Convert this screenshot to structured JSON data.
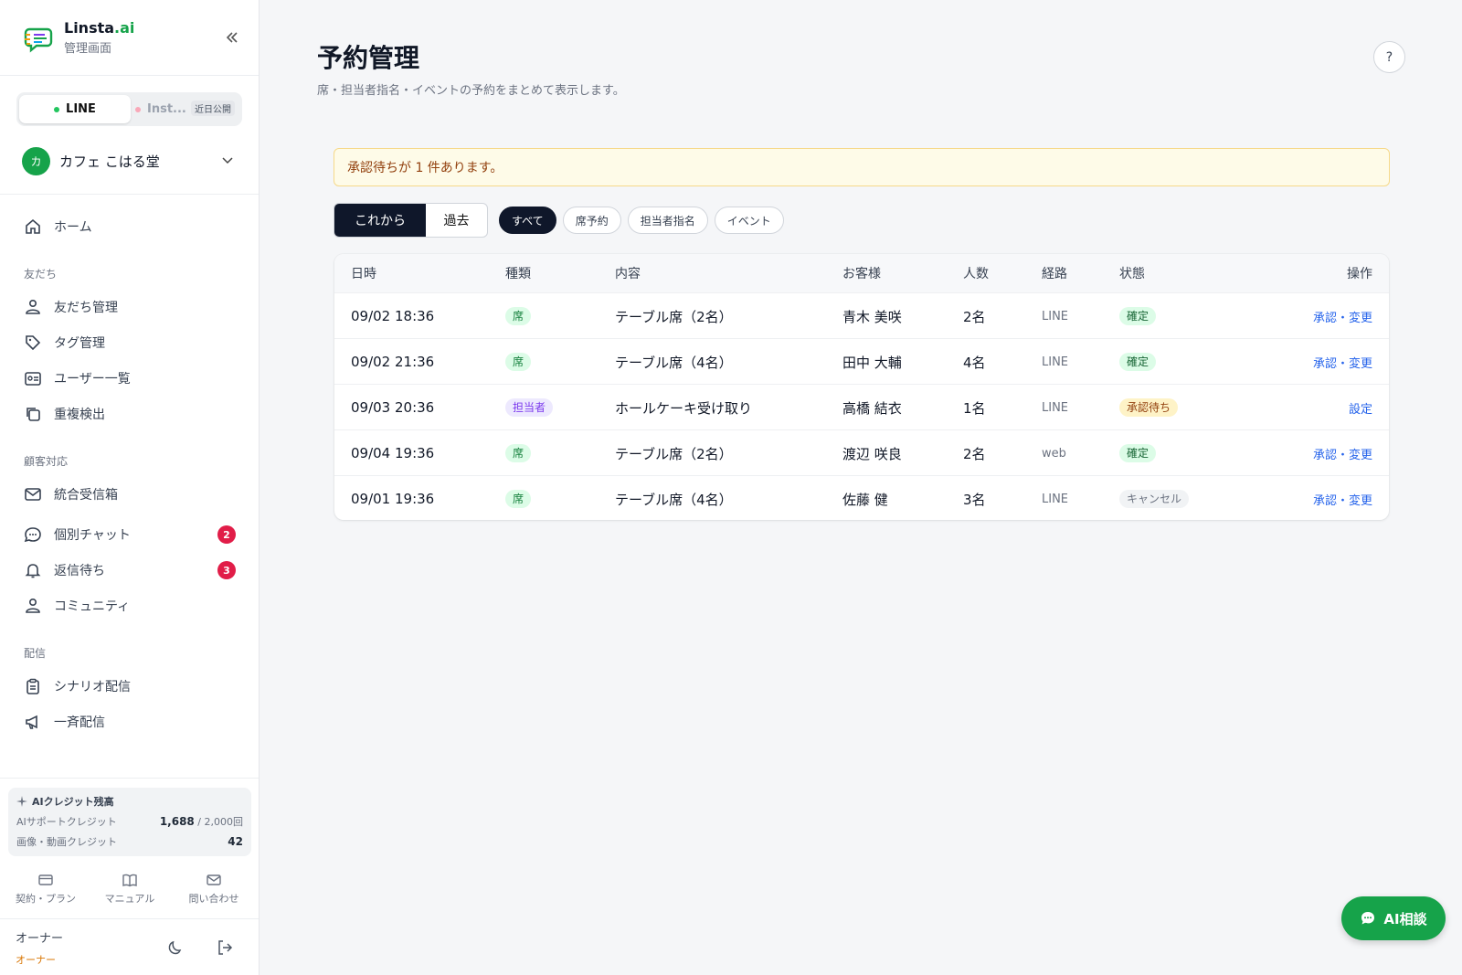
{
  "brand": {
    "name_main": "Linsta",
    "name_accent": ".ai",
    "subtitle": "管理画面"
  },
  "channels": {
    "line_label": "LINE",
    "insta_label": "Inst...",
    "soon_badge": "近日公開",
    "line_color": "#22c55e",
    "insta_color": "#f9a8b8"
  },
  "shop": {
    "avatar": "カ",
    "name": "カフェ こはる堂"
  },
  "nav": {
    "home": "ホーム",
    "group_friends": "友だち",
    "friends": "友だち管理",
    "tags": "タグ管理",
    "users": "ユーザー一覧",
    "duplicates": "重複検出",
    "group_support": "顧客対応",
    "inbox": "統合受信箱",
    "chat": "個別チャット",
    "chat_badge": "2",
    "waiting": "返信待ち",
    "waiting_badge": "3",
    "community": "コミュニティ",
    "group_delivery": "配信",
    "scenario": "シナリオ配信",
    "broadcast": "一斉配信"
  },
  "credits": {
    "title": "AIクレジット残高",
    "support_label": "AIサポートクレジット",
    "support_value": "1,688",
    "support_total": "/ 2,000回",
    "media_label": "画像・動画クレジット",
    "media_value": "42"
  },
  "quick": {
    "plan": "契約・プラン",
    "manual": "マニュアル",
    "contact": "問い合わせ"
  },
  "user": {
    "name": "オーナー",
    "role": "オーナー"
  },
  "page": {
    "title": "予約管理",
    "subtitle": "席・担当者指名・イベントの予約をまとめて表示します。",
    "help": "?"
  },
  "alert": "承認待ちが 1 件あります。",
  "segment": {
    "upcoming": "これから",
    "past": "過去"
  },
  "filters": [
    "すべて",
    "席予約",
    "担当者指名",
    "イベント"
  ],
  "table": {
    "headers": {
      "date": "日時",
      "type": "種類",
      "content": "内容",
      "customer": "お客様",
      "count": "人数",
      "source": "経路",
      "status": "状態",
      "action": "操作"
    },
    "rows": [
      {
        "date": "09/02 18:36",
        "type": "席",
        "content": "テーブル席（2名）",
        "customer": "青木 美咲",
        "count": "2名",
        "source": "LINE",
        "status": "確定",
        "action": "承認・変更"
      },
      {
        "date": "09/02 21:36",
        "type": "席",
        "content": "テーブル席（4名）",
        "customer": "田中 大輔",
        "count": "4名",
        "source": "LINE",
        "status": "確定",
        "action": "承認・変更"
      },
      {
        "date": "09/03 20:36",
        "type": "担当者",
        "content": "ホールケーキ受け取り",
        "customer": "高橋 結衣",
        "count": "1名",
        "source": "LINE",
        "status": "承認待ち",
        "action": "設定"
      },
      {
        "date": "09/04 19:36",
        "type": "席",
        "content": "テーブル席（2名）",
        "customer": "渡辺 咲良",
        "count": "2名",
        "source": "web",
        "status": "確定",
        "action": "承認・変更"
      },
      {
        "date": "09/01 19:36",
        "type": "席",
        "content": "テーブル席（4名）",
        "customer": "佐藤 健",
        "count": "3名",
        "source": "LINE",
        "status": "キャンセル",
        "action": "承認・変更"
      }
    ]
  },
  "ai_button": "AI相談"
}
